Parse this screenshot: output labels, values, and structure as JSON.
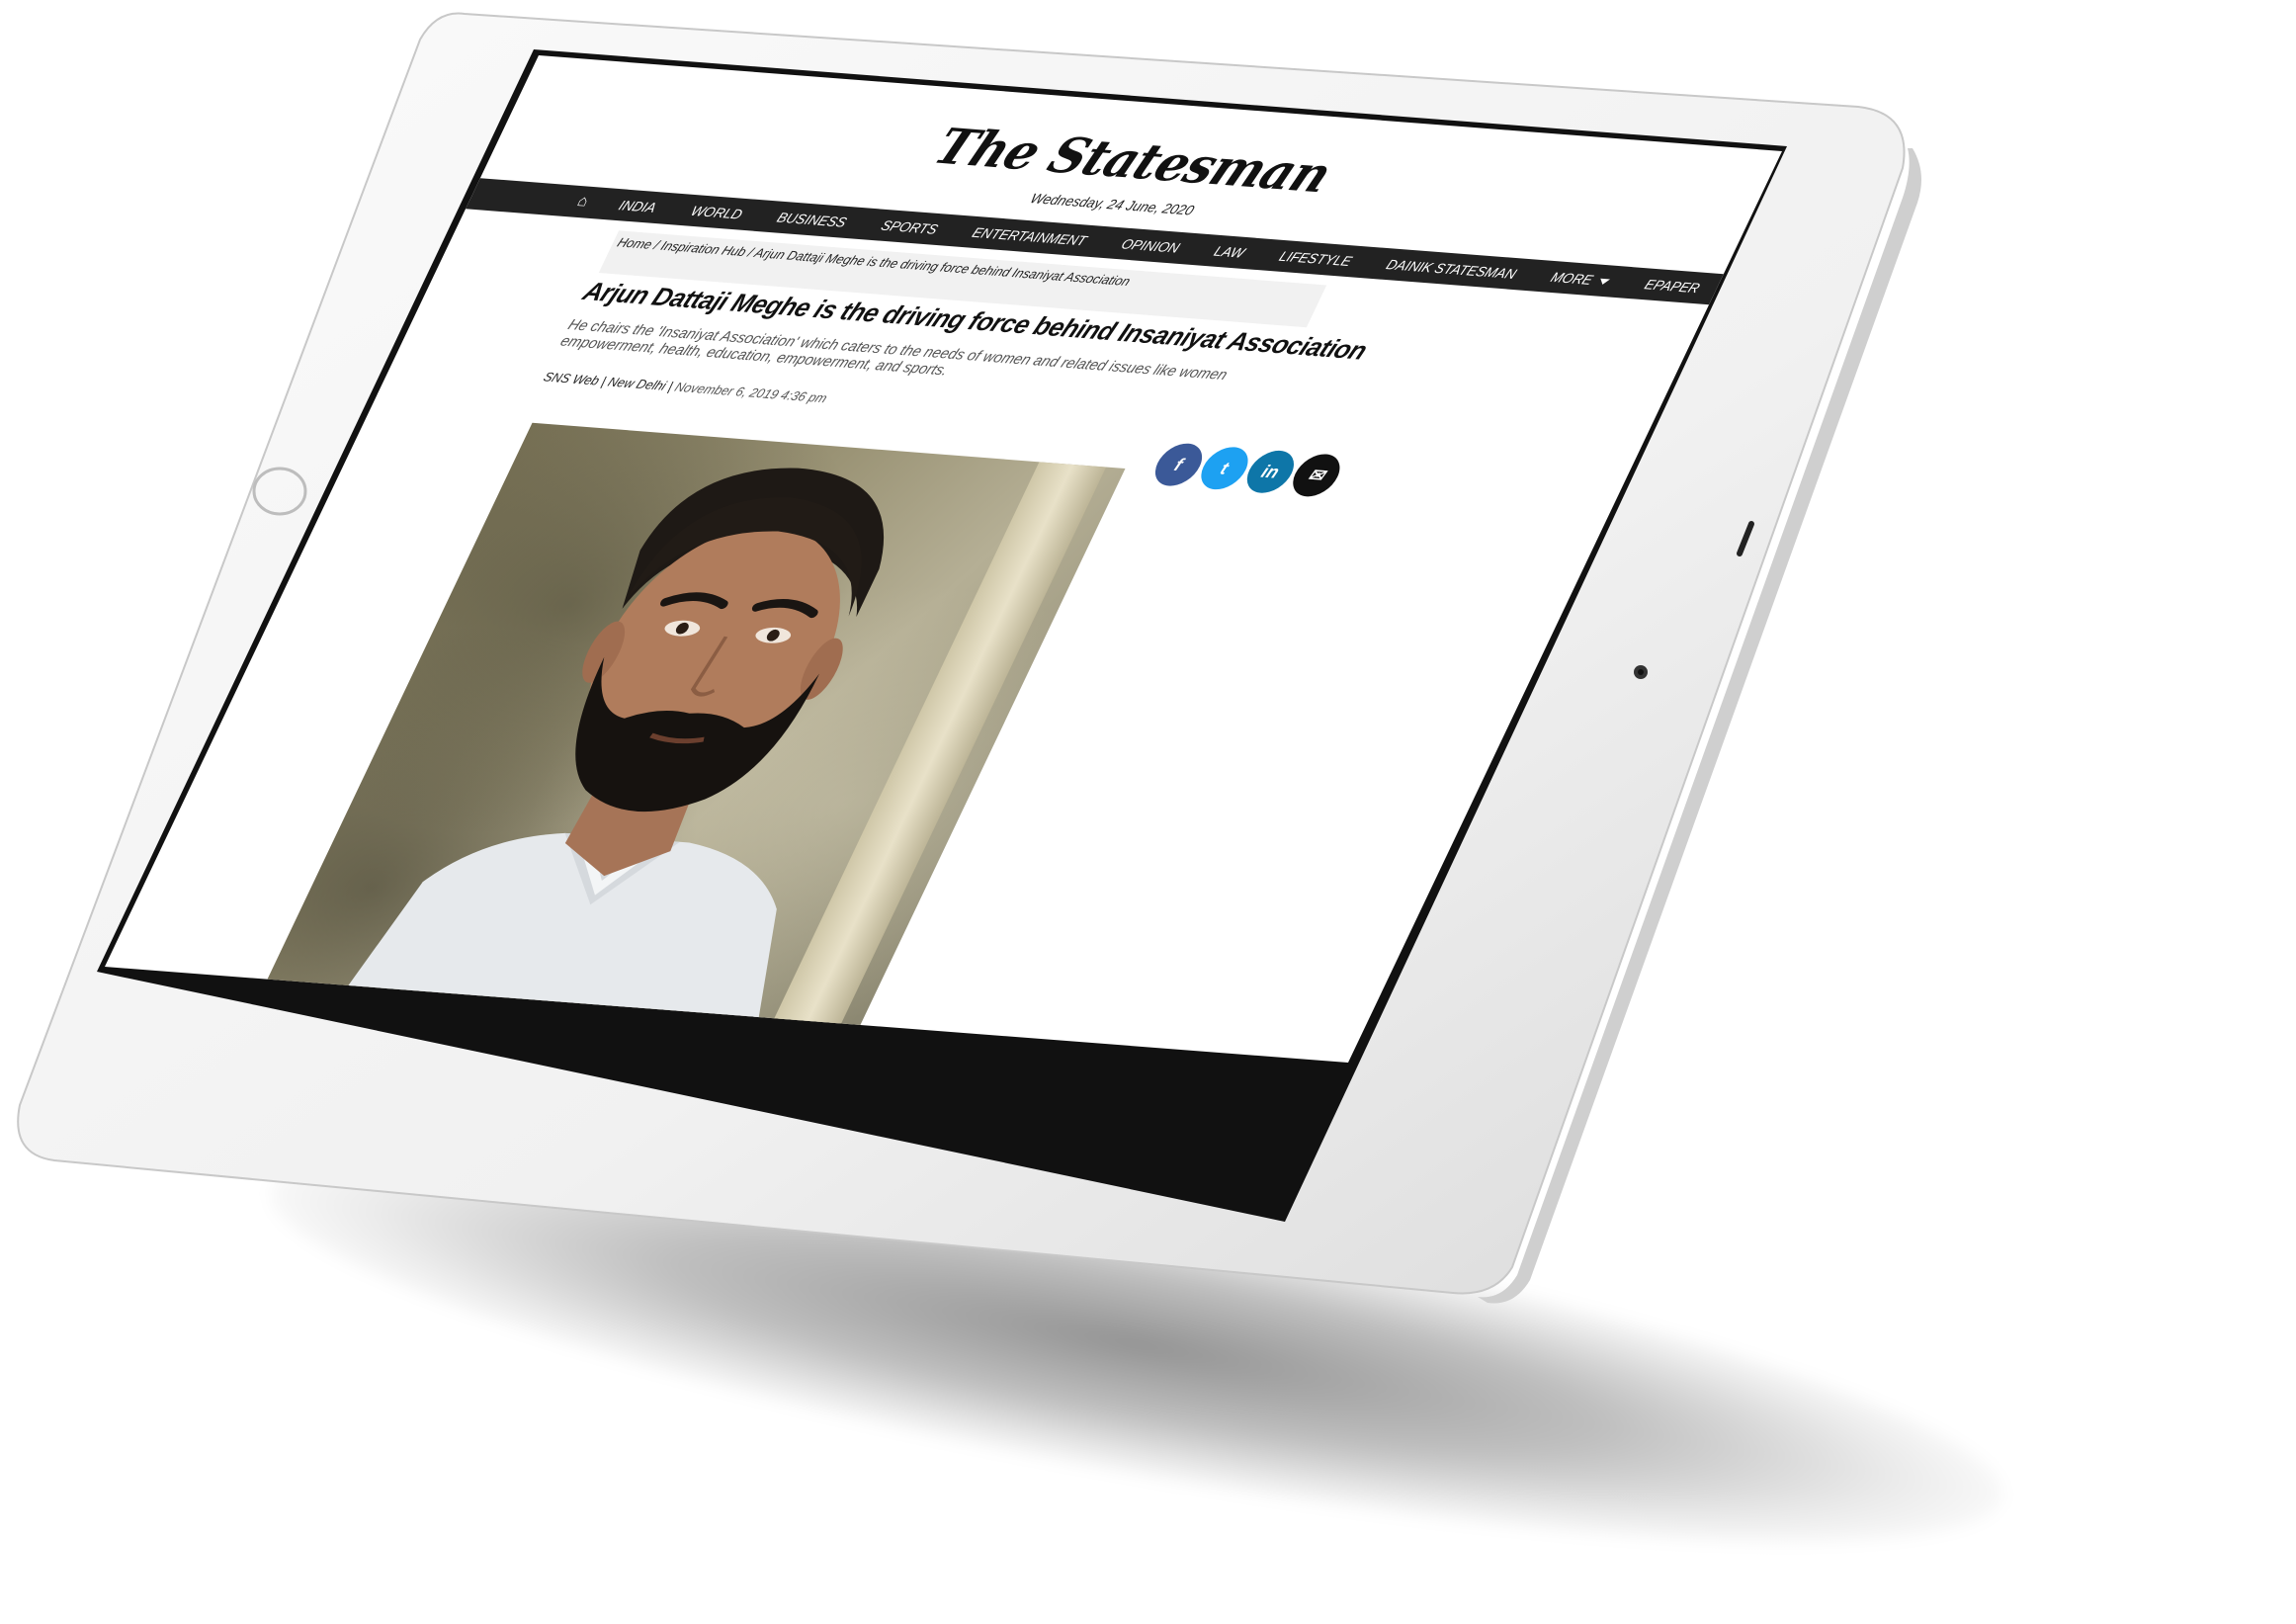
{
  "site": {
    "logo": "The Statesman",
    "date": "Wednesday, 24 June, 2020"
  },
  "nav": {
    "home_icon": "home-icon",
    "items": [
      "INDIA",
      "WORLD",
      "BUSINESS",
      "SPORTS",
      "ENTERTAINMENT",
      "OPINION",
      "LAW",
      "LIFESTYLE",
      "DAINIK STATESMAN",
      "MORE",
      "EPAPER"
    ],
    "search_icon": "search-icon"
  },
  "breadcrumb": "Home / Inspiration Hub / Arjun Dattaji Meghe is the driving force behind Insaniyat Association",
  "article": {
    "headline": "Arjun Dattaji Meghe is the driving force behind Insaniyat Association",
    "summary": "He chairs the 'Insaniyat Association' which caters to the needs of women and related issues like women empowerment, health, education, empowerment, and sports.",
    "author": "SNS Web",
    "location": "New Delhi",
    "timestamp": "November 6, 2019 4:36 pm"
  },
  "share": {
    "facebook": "f",
    "twitter": "t",
    "linkedin": "in",
    "email": "✉"
  },
  "colors": {
    "nav_bg": "#222222",
    "facebook": "#3b5998",
    "twitter": "#1da1f2",
    "linkedin": "#0e76a8",
    "email": "#111111"
  }
}
